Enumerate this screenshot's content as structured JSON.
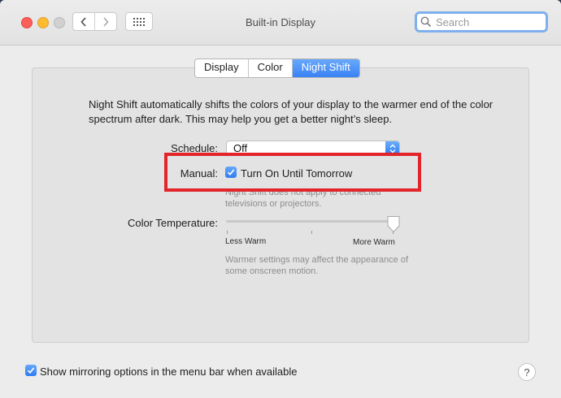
{
  "window": {
    "title": "Built-in Display"
  },
  "search": {
    "placeholder": "Search"
  },
  "tabs": [
    {
      "label": "Display",
      "active": false
    },
    {
      "label": "Color",
      "active": false
    },
    {
      "label": "Night Shift",
      "active": true
    }
  ],
  "night_shift": {
    "description": "Night Shift automatically shifts the colors of your display to the warmer end of the color spectrum after dark. This may help you get a better night’s sleep.",
    "schedule_label": "Schedule:",
    "schedule_value": "Off",
    "manual_label": "Manual:",
    "manual_checkbox_label": "Turn On Until Tomorrow",
    "manual_checked": true,
    "manual_note": "Night Shift does not apply to connected televisions or projectors.",
    "color_temp_label": "Color Temperature:",
    "color_temp_level": 1.0,
    "less_warm_label": "Less Warm",
    "more_warm_label": "More Warm",
    "warmer_note": "Warmer settings may affect the appearance of some onscreen motion."
  },
  "footer": {
    "mirroring_label": "Show mirroring options in the menu bar when available",
    "mirroring_checked": true,
    "help_label": "?"
  },
  "colors": {
    "accent": "#3882f5",
    "highlight_box": "#e2242b"
  }
}
